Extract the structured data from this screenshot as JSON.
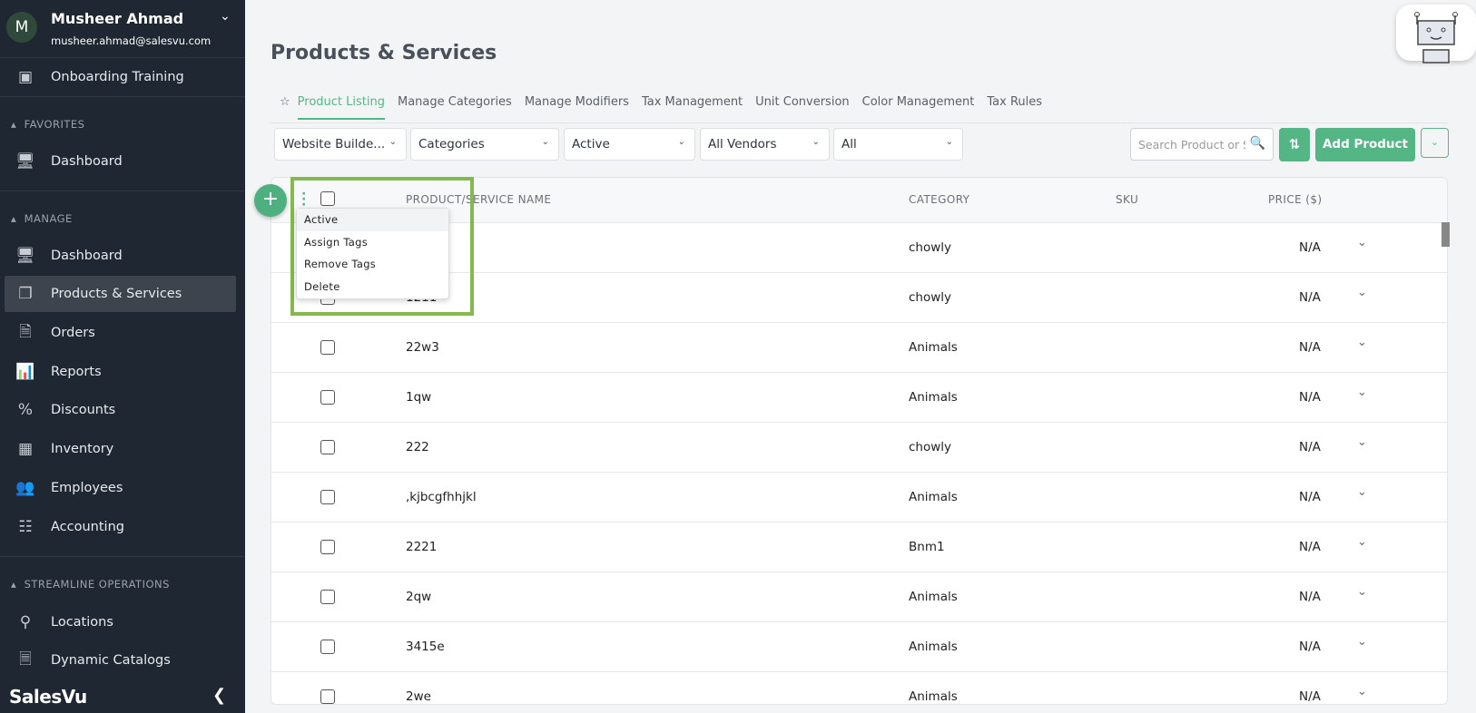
{
  "sidebar": {
    "user": {
      "initial": "M",
      "name": "Musheer Ahmad",
      "email": "musheer.ahmad@salesvu.com"
    },
    "onboarding": "Onboarding Training",
    "sections": {
      "favorites": "FAVORITES",
      "manage": "MANAGE",
      "streamline": "STREAMLINE OPERATIONS"
    },
    "favorites": [
      {
        "label": "Dashboard",
        "icon": "monitor-icon"
      }
    ],
    "manage": [
      {
        "label": "Dashboard",
        "icon": "monitor-icon"
      },
      {
        "label": "Products & Services",
        "icon": "products-icon",
        "active": true
      },
      {
        "label": "Orders",
        "icon": "orders-icon"
      },
      {
        "label": "Reports",
        "icon": "reports-icon"
      },
      {
        "label": "Discounts",
        "icon": "percent-icon"
      },
      {
        "label": "Inventory",
        "icon": "inventory-icon"
      },
      {
        "label": "Employees",
        "icon": "employees-icon"
      },
      {
        "label": "Accounting",
        "icon": "calculator-icon"
      }
    ],
    "streamline": [
      {
        "label": "Locations",
        "icon": "location-pin-icon"
      },
      {
        "label": "Dynamic Catalogs",
        "icon": "catalog-icon"
      }
    ],
    "logo": "SalesVu"
  },
  "page": {
    "title": "Products & Services"
  },
  "tabs": [
    "Product Listing",
    "Manage Categories",
    "Manage Modifiers",
    "Tax Management",
    "Unit Conversion",
    "Color Management",
    "Tax Rules"
  ],
  "filters": {
    "website": "Website Builde...",
    "categories": "Categories",
    "status": "Active",
    "vendors": "All Vendors",
    "all": "All"
  },
  "search": {
    "placeholder": "Search Product or Service"
  },
  "buttons": {
    "add_product": "Add Product"
  },
  "table": {
    "headers": {
      "name": "PRODUCT/SERVICE NAME",
      "category": "CATEGORY",
      "sku": "SKU",
      "price": "PRICE ($)"
    },
    "rows": [
      {
        "name": "",
        "category": "chowly",
        "sku": "",
        "price": "N/A"
      },
      {
        "name": "1211",
        "category": "chowly",
        "sku": "",
        "price": "N/A"
      },
      {
        "name": "22w3",
        "category": "Animals",
        "sku": "",
        "price": "N/A"
      },
      {
        "name": "1qw",
        "category": "Animals",
        "sku": "",
        "price": "N/A"
      },
      {
        "name": "222",
        "category": "chowly",
        "sku": "",
        "price": "N/A"
      },
      {
        "name": ",kjbcgfhhjkl",
        "category": "Animals",
        "sku": "",
        "price": "N/A"
      },
      {
        "name": "2221",
        "category": "Bnm1",
        "sku": "",
        "price": "N/A"
      },
      {
        "name": "2qw",
        "category": "Animals",
        "sku": "",
        "price": "N/A"
      },
      {
        "name": "3415e",
        "category": "Animals",
        "sku": "",
        "price": "N/A"
      },
      {
        "name": "2we",
        "category": "Animals",
        "sku": "",
        "price": "N/A"
      }
    ]
  },
  "bulk_menu": [
    "Active",
    "Assign Tags",
    "Remove Tags",
    "Delete"
  ],
  "colors": {
    "accent": "#55b685",
    "sidebar": "#1f2733",
    "highlight_box": "#85b84f"
  }
}
